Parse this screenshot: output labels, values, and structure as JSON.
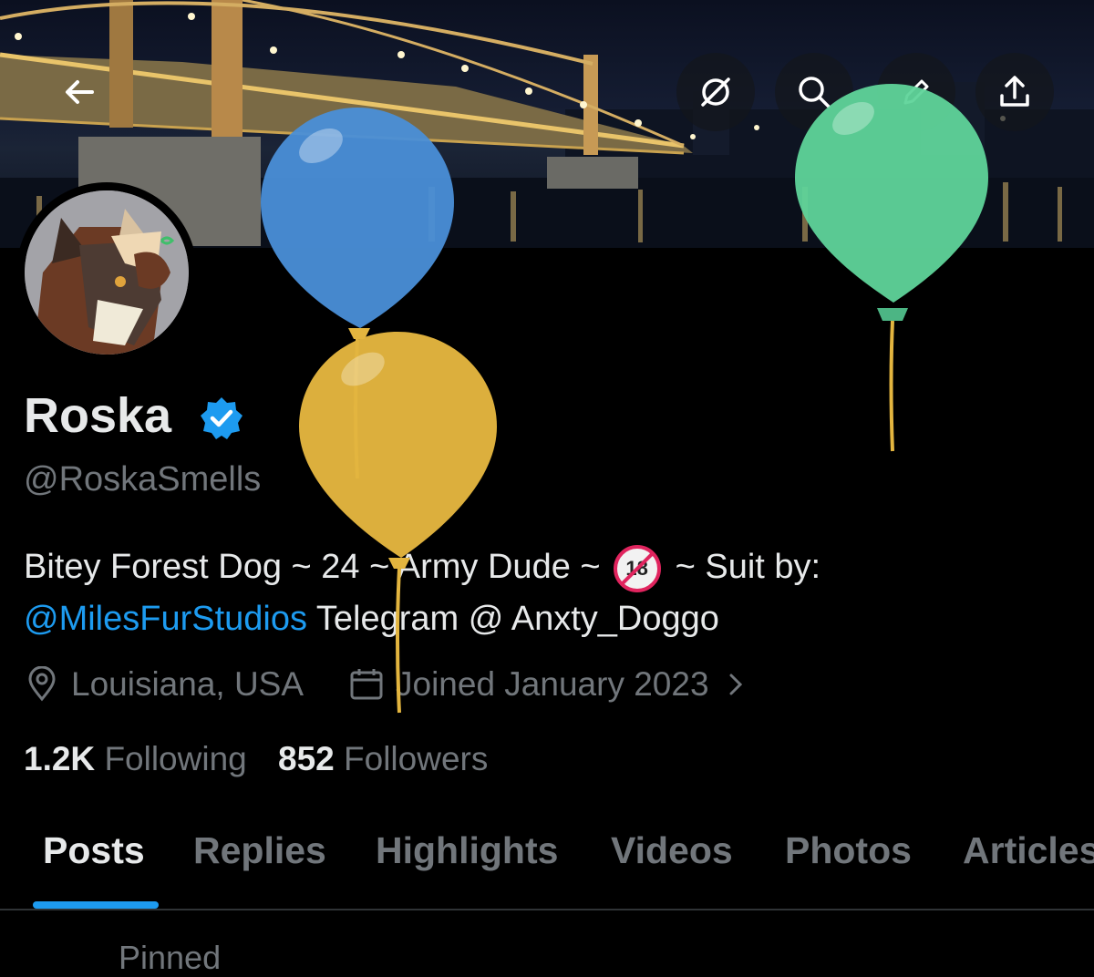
{
  "header": {
    "back_icon": "arrow-left-icon",
    "actions": [
      "mute-circle-icon",
      "search-icon",
      "edit-pencil-icon",
      "share-upload-icon"
    ]
  },
  "profile": {
    "name": "Roska",
    "handle": "@RoskaSmells",
    "verified": true,
    "bio_line1_part1": "Bitey Forest Dog ~ 24 ~ Army Dude ~",
    "bio_badge": "18",
    "bio_line1_part2": "~ Suit by:",
    "bio_mention": "@MilesFurStudios",
    "bio_line2_rest": " Telegram @ Anxty_Doggo",
    "location": "Louisiana, USA",
    "joined": "Joined January 2023"
  },
  "stats": {
    "following_count": "1.2K",
    "following_label": "Following",
    "followers_count": "852",
    "followers_label": "Followers"
  },
  "tabs": [
    "Posts",
    "Replies",
    "Highlights",
    "Videos",
    "Photos",
    "Articles"
  ],
  "active_tab": "Posts",
  "pinned_label": "Pinned",
  "colors": {
    "accent": "#1d9bf0",
    "balloon_blue": "#4a8fd8",
    "balloon_yellow": "#e3b53f",
    "balloon_green": "#5fd49a"
  }
}
